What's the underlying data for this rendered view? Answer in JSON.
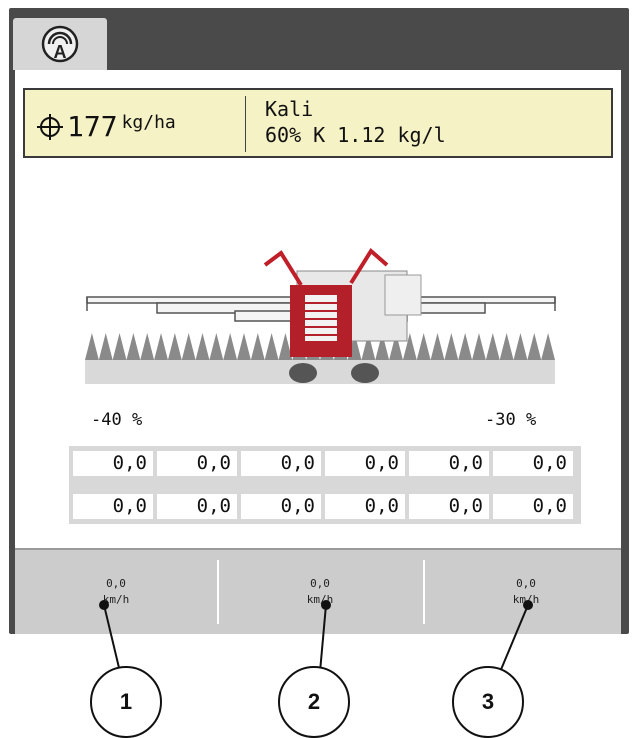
{
  "header": {
    "rate_value": "177",
    "rate_unit": "kg/ha",
    "fertilizer_name": "Kali",
    "fertilizer_spec": "60% K 1.12 kg/l"
  },
  "boom": {
    "left_percent": "-40 %",
    "right_percent": "-30 %"
  },
  "sections": {
    "row1": [
      "0,0",
      "0,0",
      "0,0",
      "0,0",
      "0,0",
      "0,0"
    ],
    "row2": [
      "0,0",
      "0,0",
      "0,0",
      "0,0",
      "0,0",
      "0,0"
    ]
  },
  "speed": [
    {
      "value": "0,0",
      "unit": "km/h"
    },
    {
      "value": "0,0",
      "unit": "km/h"
    },
    {
      "value": "0,0",
      "unit": "km/h"
    }
  ],
  "callouts": [
    "1",
    "2",
    "3"
  ],
  "icons": {
    "tab": "auto-mode-icon",
    "rate": "crosshair-icon"
  }
}
